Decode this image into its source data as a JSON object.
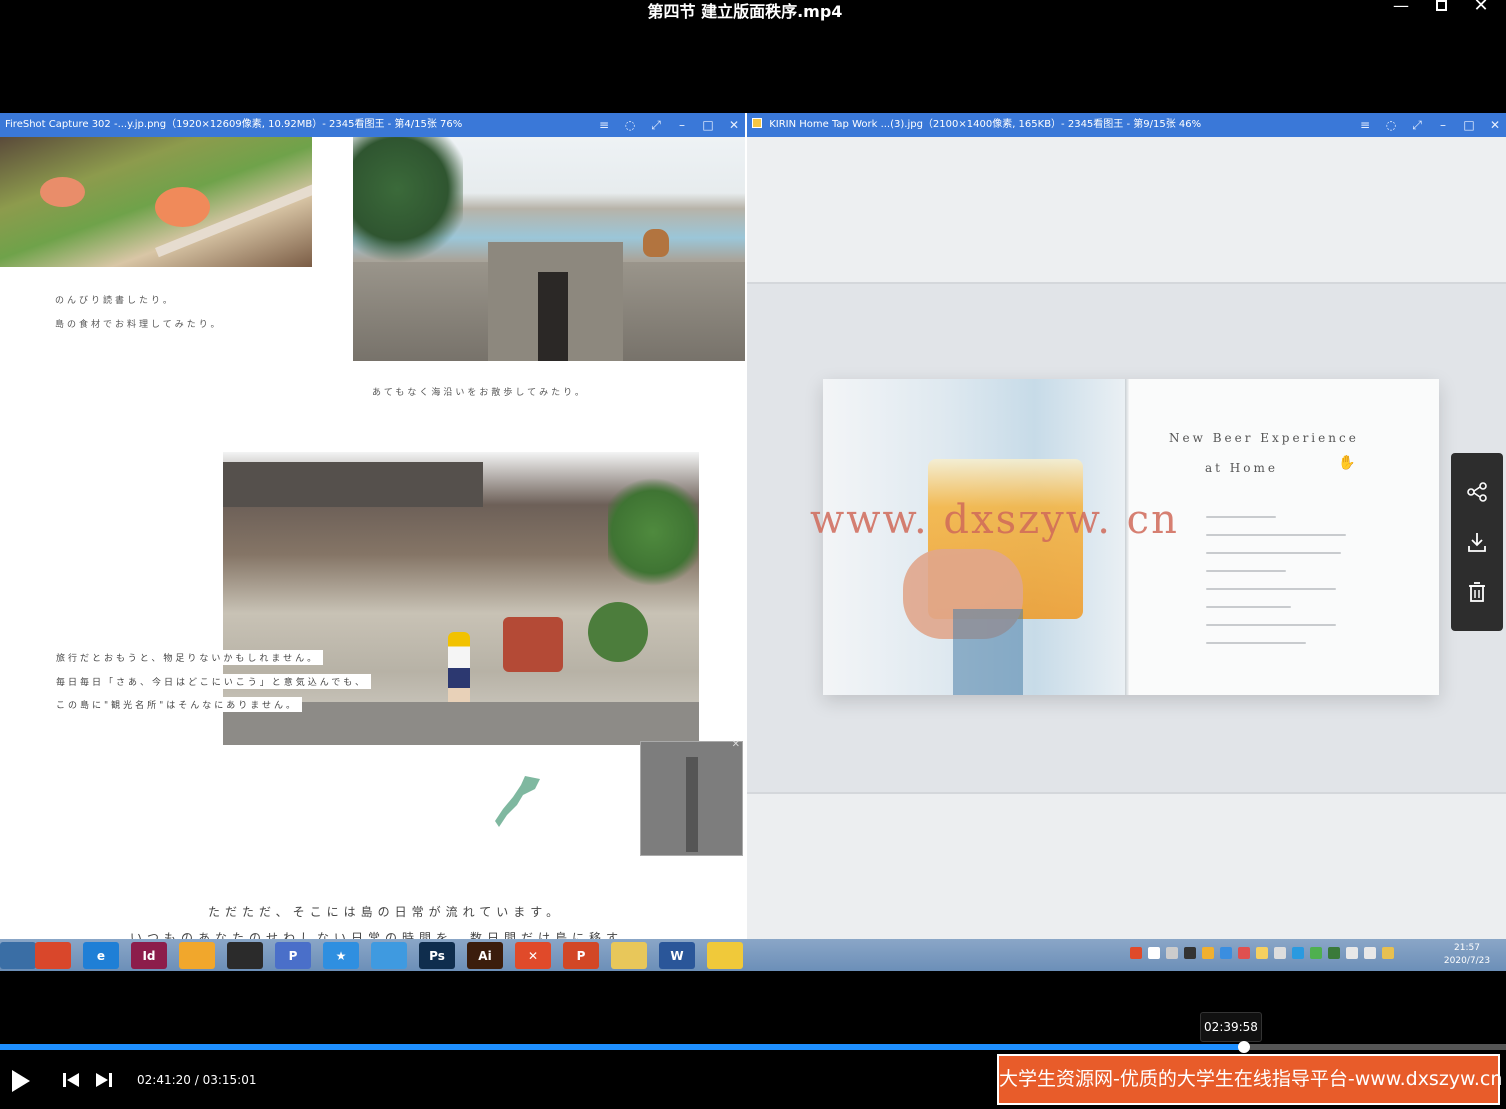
{
  "window": {
    "title": "第四节 建立版面秩序.mp4",
    "minimize_icon": "minimize-icon",
    "maximize_icon": "maximize-icon",
    "close_icon": "close-icon"
  },
  "left_viewer": {
    "title": "FireShot Capture 302 -...y.jp.png（1920×12609像素, 10.92MB）- 2345看图王 - 第4/15张 76%",
    "captions": [
      "のんびり読書したり。",
      "島の食材でお料理してみたり。",
      "あてもなく海沿いをお散歩してみたり。",
      "旅行だとおもうと、物足りないかもしれません。",
      "毎日毎日「さあ、今日はどこにいこう」と意気込んでも、",
      "この島に\"観光名所\"はそんなにありません。",
      "ただただ、そこには島の日常が流れています。",
      "いつものあなたのせわしない日常の時間を、数日間だけ島に移す"
    ]
  },
  "right_viewer": {
    "title": "KIRIN Home Tap  Work ...(3).jpg（2100×1400像素, 165KB）- 2345看图王 - 第9/15张 46%",
    "book_title": "New Beer Experience",
    "book_subtitle": "at Home"
  },
  "watermark": "www. dxszyw. cn",
  "side_panel": {
    "items": [
      "share-icon",
      "download-icon",
      "delete-icon"
    ]
  },
  "taskbar": {
    "apps": [
      {
        "name": "Start",
        "label": "",
        "color": "#3a6ea5"
      },
      {
        "name": "Chrome",
        "label": "",
        "color": "#d9472b"
      },
      {
        "name": "Browser",
        "label": "e",
        "color": "#1f7fd6"
      },
      {
        "name": "InDesign",
        "label": "Id",
        "color": "#8c1d4b"
      },
      {
        "name": "Store",
        "label": "",
        "color": "#f1a72c"
      },
      {
        "name": "OBS",
        "label": "",
        "color": "#2b2b2b"
      },
      {
        "name": "Pinyin",
        "label": "P",
        "color": "#4a6fc9"
      },
      {
        "name": "Star",
        "label": "★",
        "color": "#2f8fe0"
      },
      {
        "name": "Feiq",
        "label": "",
        "color": "#3f9ae0"
      },
      {
        "name": "Photoshop",
        "label": "Ps",
        "color": "#0f2d4d"
      },
      {
        "name": "Illustrator",
        "label": "Ai",
        "color": "#3b1d0d"
      },
      {
        "name": "Xmind",
        "label": "✕",
        "color": "#e04a2a"
      },
      {
        "name": "PowerPoint",
        "label": "P",
        "color": "#d24726"
      },
      {
        "name": "Explorer",
        "label": "",
        "color": "#e8c75a"
      },
      {
        "name": "Word",
        "label": "W",
        "color": "#2a5699"
      },
      {
        "name": "Notes",
        "label": "",
        "color": "#f0c93a"
      }
    ],
    "clock_time": "21:57",
    "clock_date": "2020/7/23"
  },
  "player": {
    "hover_time": "02:39:58",
    "current_time": "02:41:20",
    "total_time": "03:15:01",
    "progress": 0.826,
    "hover_progress": 0.815,
    "banner": "大学生资源网-优质的大学生在线指导平台-www.dxszyw.cn"
  }
}
